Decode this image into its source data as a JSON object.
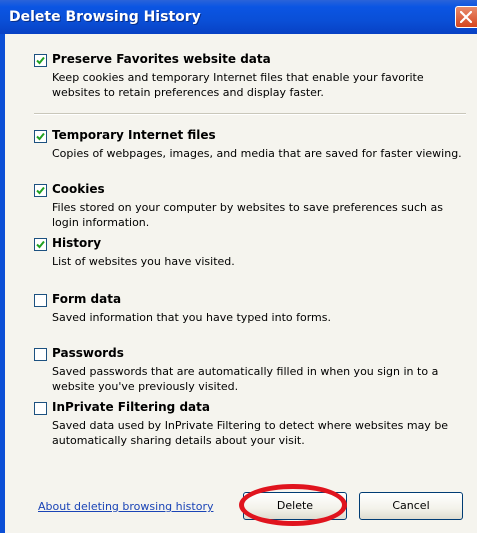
{
  "window": {
    "title": "Delete Browsing History"
  },
  "options": [
    {
      "title": "Preserve Favorites website data",
      "desc": "Keep cookies and temporary Internet files that enable your favorite websites to retain preferences and display faster.",
      "checked": true
    },
    {
      "title": "Temporary Internet files",
      "desc": "Copies of webpages, images, and media that are saved for faster viewing.",
      "checked": true
    },
    {
      "title": "Cookies",
      "desc": "Files stored on your computer by websites to save preferences such as login information.",
      "checked": true
    },
    {
      "title": "History",
      "desc": "List of websites you have visited.",
      "checked": true
    },
    {
      "title": "Form data",
      "desc": "Saved information that you have typed into forms.",
      "checked": false
    },
    {
      "title": "Passwords",
      "desc": "Saved passwords that are automatically filled in when you sign in to a website you've previously visited.",
      "checked": false
    },
    {
      "title": "InPrivate Filtering data",
      "desc": "Saved data used by InPrivate Filtering to detect where websites may be automatically sharing details about your visit.",
      "checked": false
    }
  ],
  "footer": {
    "link": "About deleting browsing history",
    "delete_label": "Delete",
    "cancel_label": "Cancel"
  },
  "colors": {
    "titlebar": "#0b55e3",
    "highlight": "#e0141e",
    "link": "#1a44b6"
  }
}
